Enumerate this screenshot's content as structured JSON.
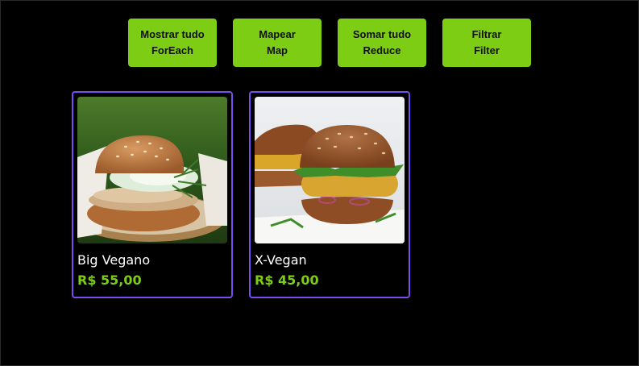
{
  "buttons": [
    {
      "line1": "Mostrar tudo",
      "line2": "ForEach"
    },
    {
      "line1": "Mapear",
      "line2": "Map"
    },
    {
      "line1": "Somar tudo",
      "line2": "Reduce"
    },
    {
      "line1": "Filtrar",
      "line2": "Filter"
    }
  ],
  "products": [
    {
      "name": "Big Vegano",
      "price": "R$ 55,00"
    },
    {
      "name": "X-Vegan",
      "price": "R$ 45,00"
    }
  ],
  "colors": {
    "background": "#000000",
    "accent_green": "#7ccd13",
    "card_border": "#7b4df0",
    "text": "#ffffff"
  }
}
